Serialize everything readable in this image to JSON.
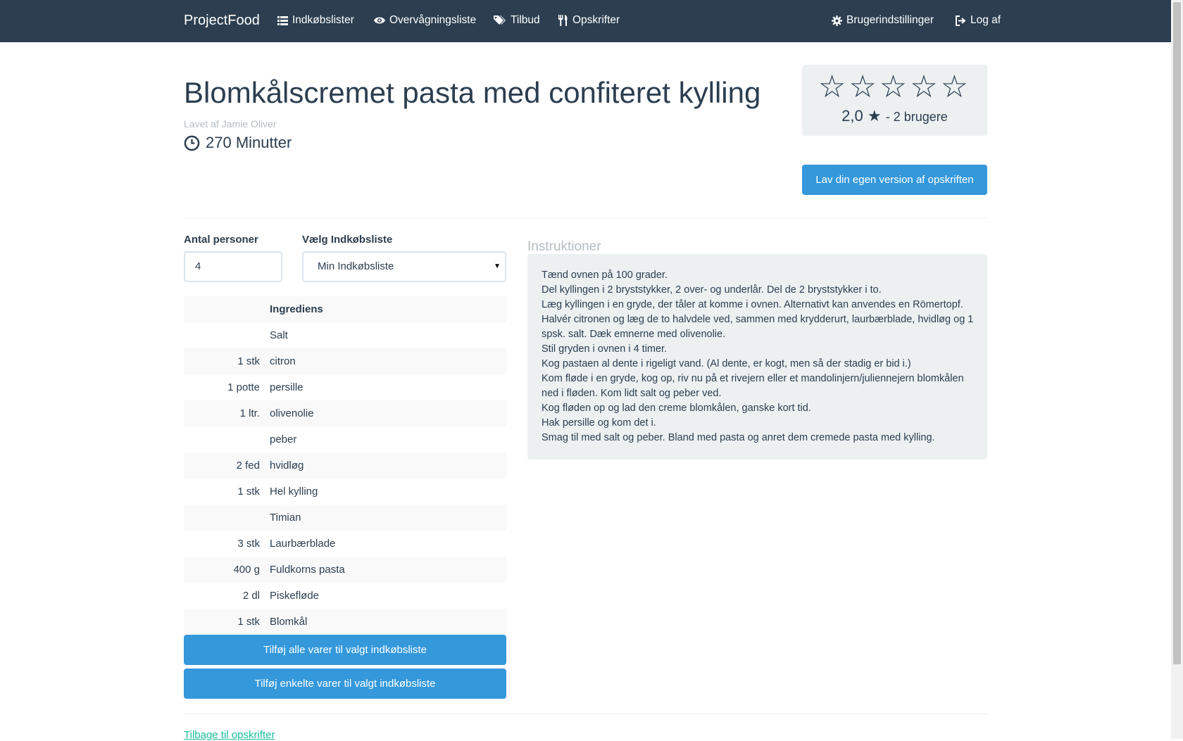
{
  "navbar": {
    "brand": "ProjectFood",
    "items": [
      {
        "label": "Indkøbslister",
        "icon": "list-icon"
      },
      {
        "label": "Overvågningsliste",
        "icon": "eye-icon"
      },
      {
        "label": "Tilbud",
        "icon": "tags-icon"
      },
      {
        "label": "Opskrifter",
        "icon": "cutlery-icon"
      }
    ],
    "right_items": [
      {
        "label": "Brugerindstillinger",
        "icon": "gear-icon"
      },
      {
        "label": "Log af",
        "icon": "logout-icon"
      }
    ],
    "background": "#2c3e50"
  },
  "recipe": {
    "title": "Blomkålscremet pasta med confiteret kylling",
    "author": "Lavet af Jamie Oliver",
    "time": "270 Minutter",
    "rating": {
      "stars_text": "☆☆☆☆☆",
      "value": "2,0",
      "star": "★",
      "users": "- 2 brugere"
    },
    "own_version_button": "Lav din egen version af opskriften"
  },
  "form": {
    "persons_label": "Antal personer",
    "persons_value": "4",
    "list_label": "Vælg Indkøbsliste",
    "list_selected": "Min Indkøbsliste"
  },
  "ingredients": {
    "header": "Ingrediens",
    "rows": [
      {
        "amount": "",
        "name": "Salt"
      },
      {
        "amount": "1 stk",
        "name": "citron"
      },
      {
        "amount": "1 potte",
        "name": "persille"
      },
      {
        "amount": "1 ltr.",
        "name": "olivenolie"
      },
      {
        "amount": "",
        "name": "peber"
      },
      {
        "amount": "2 fed",
        "name": "hvidløg"
      },
      {
        "amount": "1 stk",
        "name": "Hel kylling"
      },
      {
        "amount": "",
        "name": "Timian"
      },
      {
        "amount": "3 stk",
        "name": "Laurbærblade"
      },
      {
        "amount": "400 g",
        "name": "Fuldkorns pasta"
      },
      {
        "amount": "2 dl",
        "name": "Piskefløde"
      },
      {
        "amount": "1 stk",
        "name": "Blomkål"
      }
    ],
    "add_all_button": "Tilføj alle varer til valgt indkøbsliste",
    "add_some_button": "Tilføj enkelte varer til valgt indkøbsliste"
  },
  "instructions": {
    "title": "Instruktioner",
    "lines": [
      "Tænd ovnen på 100 grader.",
      "Del kyllingen i 2 bryststykker, 2 over- og underlår. Del de 2 bryststykker i to.",
      "Læg kyllingen i en gryde, der tåler at komme i ovnen. Alternativt kan anvendes en Römertopf.",
      "Halvér citronen og læg de to halvdele ved, sammen med krydderurt, laurbærblade, hvidløg og 1 spsk. salt. Dæk emnerne med olivenolie.",
      "Stil gryden i ovnen i 4 timer.",
      "Kog pastaen al dente i rigeligt vand. (Al dente, er kogt, men så der stadig er bid i.)",
      "Kom fløde i en gryde, kog op, riv nu på et rivejern eller et mandolinjern/juliennejern blomkålen ned i fløden. Kom lidt salt og peber ved.",
      "Kog fløden op og lad den creme blomkålen, ganske kort tid.",
      "Hak persille og kom det i.",
      "Smag til med salt og peber. Bland med pasta og anret dem cremede pasta med kylling."
    ]
  },
  "back_link": "Tilbage til opskrifter",
  "colors": {
    "primary": "#3498db",
    "dark": "#2c3e50",
    "muted": "#b4bcc2",
    "well": "#ecf0f1",
    "link": "#18bc9c"
  }
}
